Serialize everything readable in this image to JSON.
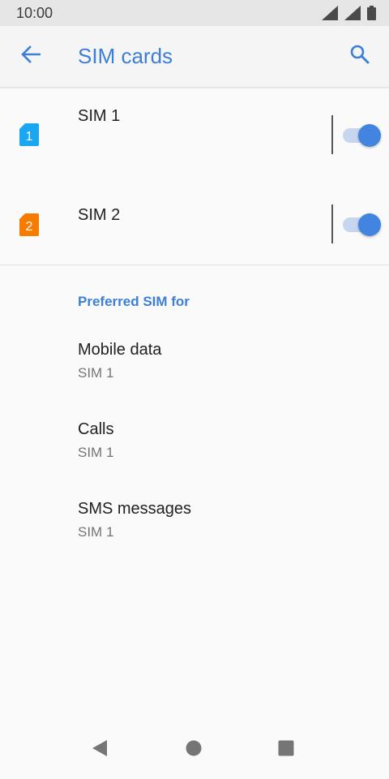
{
  "status_bar": {
    "time": "10:00",
    "icons": [
      "signal-icon",
      "signal-icon",
      "battery-icon"
    ]
  },
  "app_bar": {
    "title": "SIM cards",
    "back_icon": "arrow-back-icon",
    "search_icon": "search-icon"
  },
  "colors": {
    "accent": "#3d7fd6",
    "sim1": "#1aa6f0",
    "sim2": "#f57c00",
    "toggle_thumb": "#4285e0",
    "toggle_track": "#c7d6ef"
  },
  "sims": [
    {
      "label": "SIM 1",
      "badge": "1",
      "enabled": true
    },
    {
      "label": "SIM 2",
      "badge": "2",
      "enabled": true
    }
  ],
  "preferred": {
    "header": "Preferred SIM for",
    "items": [
      {
        "title": "Mobile data",
        "value": "SIM 1"
      },
      {
        "title": "Calls",
        "value": "SIM 1"
      },
      {
        "title": "SMS messages",
        "value": "SIM 1"
      }
    ]
  },
  "nav_bar": {
    "buttons": [
      "back-triangle-icon",
      "home-circle-icon",
      "recents-square-icon"
    ]
  }
}
